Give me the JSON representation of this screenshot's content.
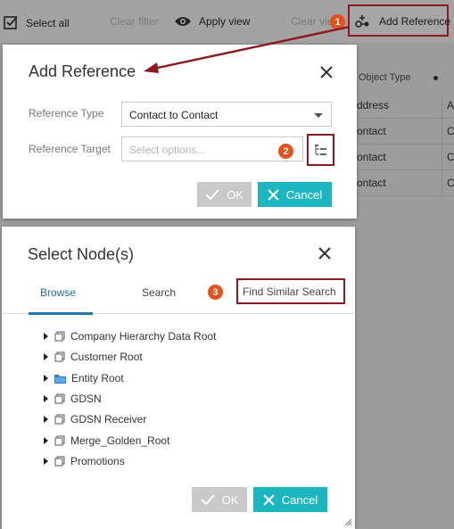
{
  "toolbar": {
    "select_all": "Select all",
    "clear_filter": "Clear filter",
    "apply_view": "Apply view",
    "clear_view": "Clear vie",
    "add_reference": "Add Reference"
  },
  "background_table": {
    "header": "Object Type",
    "rows": [
      {
        "col1": "ddress",
        "col2": "A"
      },
      {
        "col1": "ontact",
        "col2": "C"
      },
      {
        "col1": "ontact",
        "col2": "C"
      },
      {
        "col1": "ontact",
        "col2": "C"
      }
    ]
  },
  "add_reference_dialog": {
    "title": "Add Reference",
    "reference_type_label": "Reference Type",
    "reference_type_value": "Contact to Contact",
    "reference_target_label": "Reference Target",
    "reference_target_placeholder": "Select options...",
    "ok_label": "OK",
    "cancel_label": "Cancel"
  },
  "select_nodes_dialog": {
    "title": "Select Node(s)",
    "tabs": [
      "Browse",
      "Search",
      "Find Similar Search"
    ],
    "tree_items": [
      {
        "label": "Company Hierarchy Data Root",
        "icon": "node-icon"
      },
      {
        "label": "Customer Root",
        "icon": "node-icon"
      },
      {
        "label": "Entity Root",
        "icon": "folder-icon"
      },
      {
        "label": "GDSN",
        "icon": "node-icon"
      },
      {
        "label": "GDSN Receiver",
        "icon": "node-icon"
      },
      {
        "label": "Merge_Golden_Root",
        "icon": "node-icon"
      },
      {
        "label": "Promotions",
        "icon": "node-icon"
      }
    ],
    "ok_label": "OK",
    "cancel_label": "Cancel"
  },
  "badges": [
    "1",
    "2",
    "3"
  ],
  "colors": {
    "accent_teal": "#1bb6bf",
    "callout_red": "#8b1a1f",
    "badge_orange": "#e5501b",
    "tab_blue": "#1f77b4"
  }
}
